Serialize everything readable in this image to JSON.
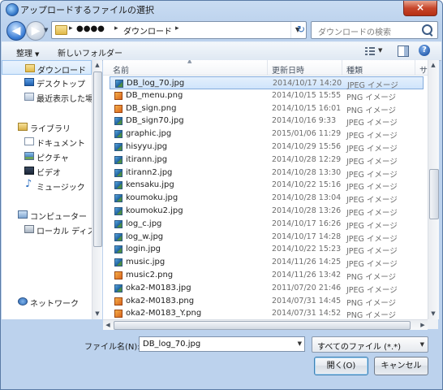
{
  "window": {
    "title": "アップロードするファイルの選択",
    "close_label": "×"
  },
  "address": {
    "hidden_segment": "●●●●",
    "folder": "ダウンロード",
    "separator": "▸"
  },
  "search": {
    "placeholder": "ダウンロードの検索"
  },
  "toolbar": {
    "organize_label": "整理",
    "new_folder_label": "新しいフォルダー"
  },
  "nav": {
    "favorites": [
      {
        "label": "ダウンロード",
        "icon": "download-folder-icon"
      },
      {
        "label": "デスクトップ",
        "icon": "desktop-icon"
      },
      {
        "label": "最近表示した場所",
        "icon": "recent-places-icon"
      }
    ],
    "library": {
      "label": "ライブラリ",
      "items": [
        {
          "label": "ドキュメント",
          "icon": "documents-icon"
        },
        {
          "label": "ピクチャ",
          "icon": "pictures-icon"
        },
        {
          "label": "ビデオ",
          "icon": "videos-icon"
        },
        {
          "label": "ミュージック",
          "icon": "music-icon"
        }
      ]
    },
    "computer": {
      "label": "コンピューター",
      "items": [
        {
          "label": "ローカル ディスク",
          "icon": "local-disk-icon"
        }
      ]
    },
    "network": {
      "label": "ネットワーク"
    }
  },
  "columns": {
    "name": "名前",
    "date": "更新日時",
    "type": "種類",
    "size": "サ"
  },
  "files": [
    {
      "name": "DB_log_70.jpg",
      "date": "2014/10/17 14:20",
      "type": "JPEG イメージ",
      "kind": "jpg",
      "selected": true
    },
    {
      "name": "DB_menu.png",
      "date": "2014/10/15 15:55",
      "type": "PNG イメージ",
      "kind": "png"
    },
    {
      "name": "DB_sign.png",
      "date": "2014/10/15 16:01",
      "type": "PNG イメージ",
      "kind": "png"
    },
    {
      "name": "DB_sign70.jpg",
      "date": "2014/10/16 9:33",
      "type": "JPEG イメージ",
      "kind": "jpg"
    },
    {
      "name": "graphic.jpg",
      "date": "2015/01/06 11:29",
      "type": "JPEG イメージ",
      "kind": "jpg"
    },
    {
      "name": "hisyyu.jpg",
      "date": "2014/10/29 15:56",
      "type": "JPEG イメージ",
      "kind": "jpg"
    },
    {
      "name": "itirann.jpg",
      "date": "2014/10/28 12:29",
      "type": "JPEG イメージ",
      "kind": "jpg"
    },
    {
      "name": "itirann2.jpg",
      "date": "2014/10/28 13:30",
      "type": "JPEG イメージ",
      "kind": "jpg"
    },
    {
      "name": "kensaku.jpg",
      "date": "2014/10/22 15:16",
      "type": "JPEG イメージ",
      "kind": "jpg"
    },
    {
      "name": "koumoku.jpg",
      "date": "2014/10/28 13:04",
      "type": "JPEG イメージ",
      "kind": "jpg"
    },
    {
      "name": "koumoku2.jpg",
      "date": "2014/10/28 13:26",
      "type": "JPEG イメージ",
      "kind": "jpg"
    },
    {
      "name": "log_c.jpg",
      "date": "2014/10/17 16:26",
      "type": "JPEG イメージ",
      "kind": "jpg"
    },
    {
      "name": "log_w.jpg",
      "date": "2014/10/17 14:28",
      "type": "JPEG イメージ",
      "kind": "jpg"
    },
    {
      "name": "login.jpg",
      "date": "2014/10/22 15:23",
      "type": "JPEG イメージ",
      "kind": "jpg"
    },
    {
      "name": "music.jpg",
      "date": "2014/11/26 14:25",
      "type": "JPEG イメージ",
      "kind": "jpg"
    },
    {
      "name": "music2.png",
      "date": "2014/11/26 13:42",
      "type": "PNG イメージ",
      "kind": "png"
    },
    {
      "name": "oka2-M0183.jpg",
      "date": "2011/07/20 21:46",
      "type": "JPEG イメージ",
      "kind": "jpg"
    },
    {
      "name": "oka2-M0183.png",
      "date": "2014/07/31 14:45",
      "type": "PNG イメージ",
      "kind": "png"
    },
    {
      "name": "oka2-M0183_Y.png",
      "date": "2014/07/31 14:52",
      "type": "PNG イメージ",
      "kind": "png"
    }
  ],
  "bottom": {
    "filename_label": "ファイル名(N):",
    "filename_value": "DB_log_70.jpg",
    "filetype_value": "すべてのファイル (*.*)",
    "open_label": "開く(O)",
    "cancel_label": "キャンセル"
  }
}
